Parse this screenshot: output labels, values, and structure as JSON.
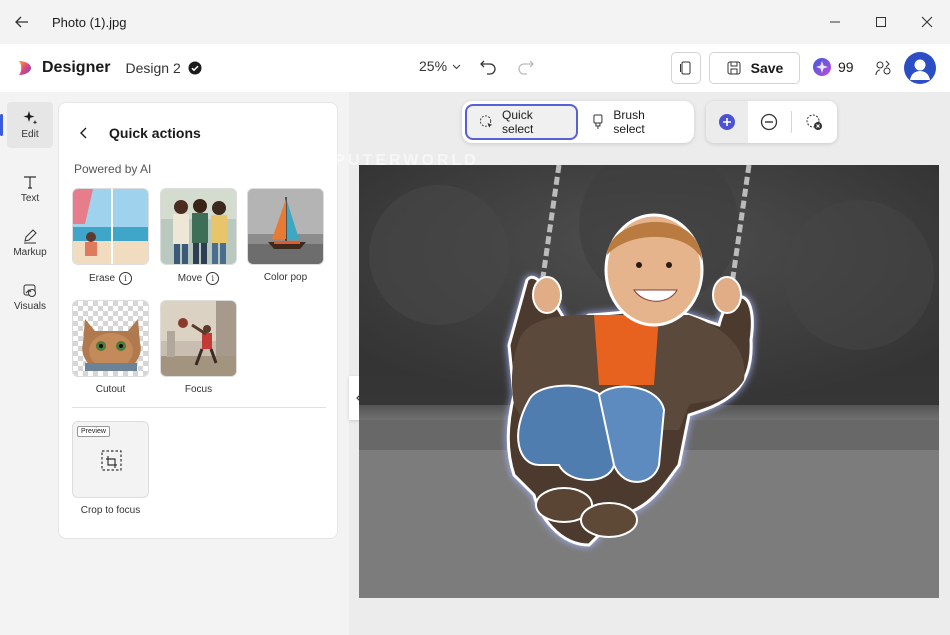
{
  "window": {
    "title": "Photo (1).jpg"
  },
  "header": {
    "brand": "Designer",
    "design_name": "Design 2",
    "zoom": "25%",
    "save_label": "Save",
    "credits": "99"
  },
  "rail": [
    {
      "label": "Edit",
      "icon": "sparkle-icon"
    },
    {
      "label": "Text",
      "icon": "text-icon"
    },
    {
      "label": "Markup",
      "icon": "pen-icon"
    },
    {
      "label": "Visuals",
      "icon": "image-icon"
    }
  ],
  "panel": {
    "title": "Quick actions",
    "section": "Powered by AI",
    "actions": [
      {
        "label": "Erase"
      },
      {
        "label": "Move"
      },
      {
        "label": "Color pop"
      },
      {
        "label": "Cutout"
      },
      {
        "label": "Focus"
      }
    ],
    "preview": {
      "badge": "Preview",
      "label": "Crop to focus"
    }
  },
  "select_toolbar": {
    "quick_select": "Quick select",
    "brush_select": "Brush select"
  },
  "watermark": "COMPUTERWORLD",
  "colors": {
    "accent": "#5860d8",
    "avatar": "#2c4ec4"
  }
}
